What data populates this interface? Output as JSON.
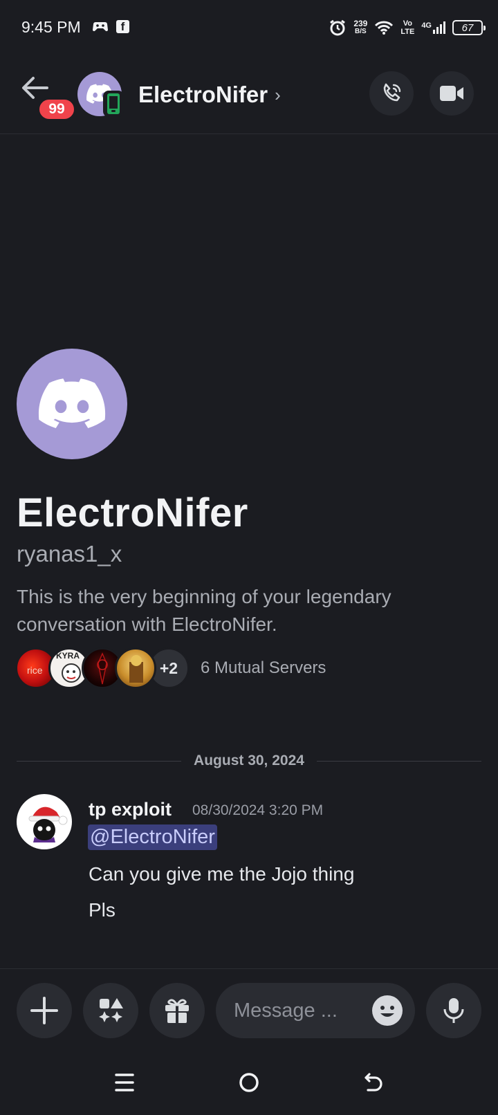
{
  "status_bar": {
    "time": "9:45 PM",
    "net_speed_value": "239",
    "net_speed_unit": "B/S",
    "volte_top": "Vo",
    "volte_bottom": "LTE",
    "network": "4G",
    "battery": "67"
  },
  "header": {
    "unread_badge": "99",
    "title": "ElectroNifer",
    "chevron": "›"
  },
  "profile": {
    "display_name": "ElectroNifer",
    "username": "ryanas1_x",
    "intro": "This is the very beginning of your legendary conversation with ElectroNifer.",
    "mutual_servers": {
      "icons": [
        {
          "name": "server-rice",
          "text": "rice"
        },
        {
          "name": "server-kyra-scripts",
          "text": "KYRA"
        },
        {
          "name": "server-dark",
          "text": ""
        },
        {
          "name": "server-gold",
          "text": ""
        }
      ],
      "more": "+2",
      "label": "6 Mutual Servers"
    }
  },
  "conversation": {
    "date_divider": "August 30, 2024",
    "messages": [
      {
        "author": "tp exploit",
        "timestamp": "08/30/2024 3:20 PM",
        "mention": "@ElectroNifer",
        "lines": [
          "Can you give me the Jojo thing",
          "Pls"
        ]
      }
    ]
  },
  "composer": {
    "placeholder": "Message ..."
  },
  "colors": {
    "background": "#1b1c21",
    "blurple_avatar": "#a59ad6",
    "badge_red": "#f0434b",
    "mention_bg": "#3b3f7c",
    "online_mobile_green": "#23a55a"
  },
  "icons": [
    "back-arrow-icon",
    "phone-icon",
    "video-camera-icon",
    "plus-icon",
    "apps-icon",
    "gift-icon",
    "emoji-icon",
    "microphone-icon",
    "mobile-status-icon"
  ]
}
